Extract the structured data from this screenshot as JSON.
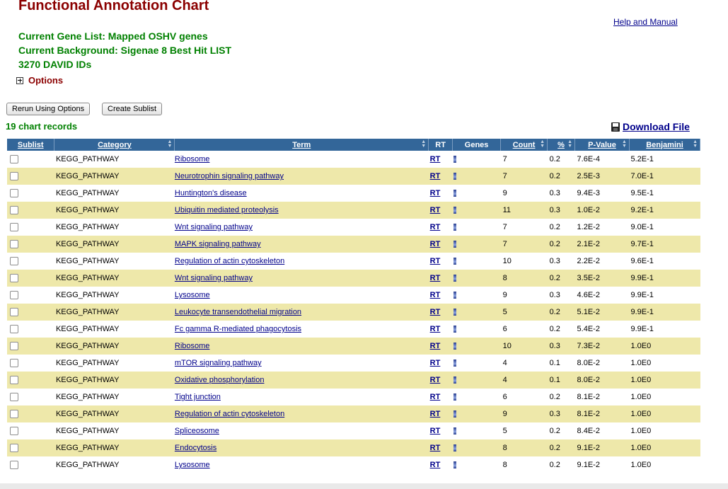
{
  "header": {
    "title": "Functional Annotation Chart",
    "help_link": "Help and Manual",
    "gene_list": "Current Gene List: Mapped OSHV genes",
    "background": "Current Background: Sigenae 8 Best Hit LIST",
    "david_ids": "3270 DAVID IDs",
    "options_label": "Options"
  },
  "toolbar": {
    "rerun_label": "Rerun Using Options",
    "sublist_label": "Create Sublist",
    "records_count": "19 chart records",
    "download_label": "Download File"
  },
  "table": {
    "columns": [
      "Sublist",
      "Category",
      "Term",
      "RT",
      "Genes",
      "Count",
      "%",
      "P-Value",
      "Benjamini"
    ],
    "rows": [
      {
        "category": "KEGG_PATHWAY",
        "term": "Ribosome",
        "rt": "RT",
        "count": "7",
        "percent": "0.2",
        "pvalue": "7.6E-4",
        "benjamini": "5.2E-1"
      },
      {
        "category": "KEGG_PATHWAY",
        "term": "Neurotrophin signaling pathway",
        "rt": "RT",
        "count": "7",
        "percent": "0.2",
        "pvalue": "2.5E-3",
        "benjamini": "7.0E-1"
      },
      {
        "category": "KEGG_PATHWAY",
        "term": "Huntington's disease",
        "rt": "RT",
        "count": "9",
        "percent": "0.3",
        "pvalue": "9.4E-3",
        "benjamini": "9.5E-1"
      },
      {
        "category": "KEGG_PATHWAY",
        "term": "Ubiquitin mediated proteolysis",
        "rt": "RT",
        "count": "11",
        "percent": "0.3",
        "pvalue": "1.0E-2",
        "benjamini": "9.2E-1"
      },
      {
        "category": "KEGG_PATHWAY",
        "term": "Wnt signaling pathway",
        "rt": "RT",
        "count": "7",
        "percent": "0.2",
        "pvalue": "1.2E-2",
        "benjamini": "9.0E-1"
      },
      {
        "category": "KEGG_PATHWAY",
        "term": "MAPK signaling pathway",
        "rt": "RT",
        "count": "7",
        "percent": "0.2",
        "pvalue": "2.1E-2",
        "benjamini": "9.7E-1"
      },
      {
        "category": "KEGG_PATHWAY",
        "term": "Regulation of actin cytoskeleton",
        "rt": "RT",
        "count": "10",
        "percent": "0.3",
        "pvalue": "2.2E-2",
        "benjamini": "9.6E-1"
      },
      {
        "category": "KEGG_PATHWAY",
        "term": "Wnt signaling pathway",
        "rt": "RT",
        "count": "8",
        "percent": "0.2",
        "pvalue": "3.5E-2",
        "benjamini": "9.9E-1"
      },
      {
        "category": "KEGG_PATHWAY",
        "term": "Lysosome",
        "rt": "RT",
        "count": "9",
        "percent": "0.3",
        "pvalue": "4.6E-2",
        "benjamini": "9.9E-1"
      },
      {
        "category": "KEGG_PATHWAY",
        "term": "Leukocyte transendothelial migration",
        "rt": "RT",
        "count": "5",
        "percent": "0.2",
        "pvalue": "5.1E-2",
        "benjamini": "9.9E-1"
      },
      {
        "category": "KEGG_PATHWAY",
        "term": "Fc gamma R-mediated phagocytosis",
        "rt": "RT",
        "count": "6",
        "percent": "0.2",
        "pvalue": "5.4E-2",
        "benjamini": "9.9E-1"
      },
      {
        "category": "KEGG_PATHWAY",
        "term": "Ribosome",
        "rt": "RT",
        "count": "10",
        "percent": "0.3",
        "pvalue": "7.3E-2",
        "benjamini": "1.0E0"
      },
      {
        "category": "KEGG_PATHWAY",
        "term": "mTOR signaling pathway",
        "rt": "RT",
        "count": "4",
        "percent": "0.1",
        "pvalue": "8.0E-2",
        "benjamini": "1.0E0"
      },
      {
        "category": "KEGG_PATHWAY",
        "term": "Oxidative phosphorylation",
        "rt": "RT",
        "count": "4",
        "percent": "0.1",
        "pvalue": "8.0E-2",
        "benjamini": "1.0E0"
      },
      {
        "category": "KEGG_PATHWAY",
        "term": "Tight junction",
        "rt": "RT",
        "count": "6",
        "percent": "0.2",
        "pvalue": "8.1E-2",
        "benjamini": "1.0E0"
      },
      {
        "category": "KEGG_PATHWAY",
        "term": "Regulation of actin cytoskeleton",
        "rt": "RT",
        "count": "9",
        "percent": "0.3",
        "pvalue": "8.1E-2",
        "benjamini": "1.0E0"
      },
      {
        "category": "KEGG_PATHWAY",
        "term": "Spliceosome",
        "rt": "RT",
        "count": "5",
        "percent": "0.2",
        "pvalue": "8.4E-2",
        "benjamini": "1.0E0"
      },
      {
        "category": "KEGG_PATHWAY",
        "term": "Endocytosis",
        "rt": "RT",
        "count": "8",
        "percent": "0.2",
        "pvalue": "9.1E-2",
        "benjamini": "1.0E0"
      },
      {
        "category": "KEGG_PATHWAY",
        "term": "Lysosome",
        "rt": "RT",
        "count": "8",
        "percent": "0.2",
        "pvalue": "9.1E-2",
        "benjamini": "1.0E0"
      }
    ]
  },
  "colors": {
    "title": "#8b0000",
    "info_text": "#008000",
    "link": "#00008b",
    "header_bg": "#336699",
    "alt_row_bg": "#eee8aa"
  }
}
